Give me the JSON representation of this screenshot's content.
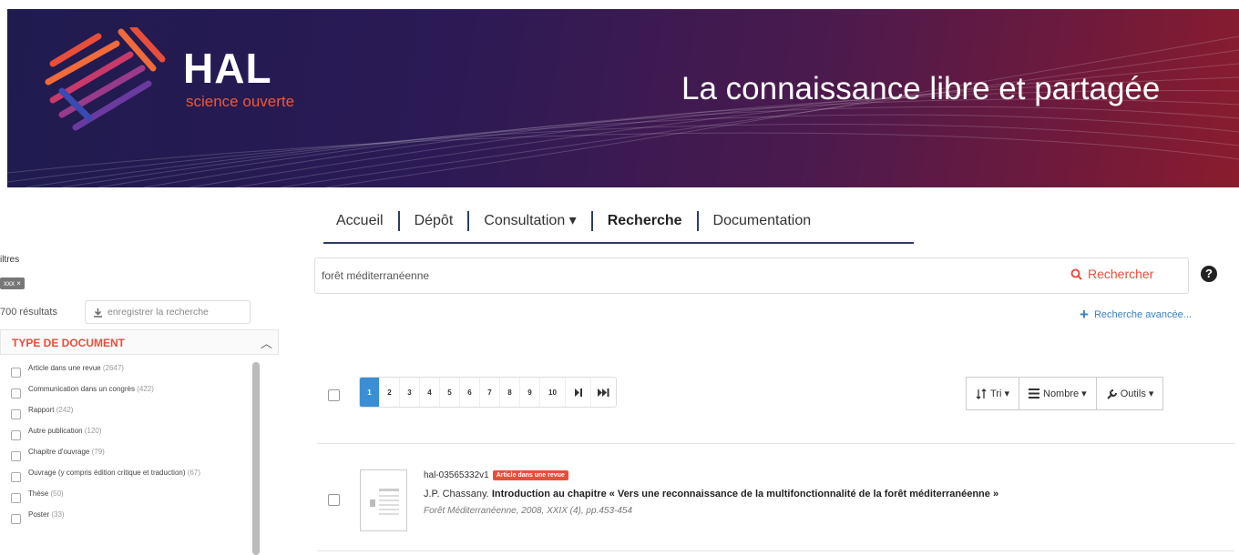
{
  "banner": {
    "logo_title": "HAL",
    "logo_subtitle": "science ouverte",
    "tagline": "La connaissance libre et partagée"
  },
  "nav": {
    "items": [
      "Accueil",
      "Dépôt",
      "Consultation ▾",
      "Recherche",
      "Documentation"
    ],
    "active": "Recherche"
  },
  "search": {
    "value": "forêt méditerranéenne",
    "button_label": "Rechercher",
    "help_icon": "?",
    "advanced_label": "Recherche avancée..."
  },
  "sidebar": {
    "filters_title": "iltres",
    "filter_badge": "xxx ×",
    "results_count": "700 résultats",
    "save_search_label": "enregistrer la recherche",
    "facet": {
      "title": "TYPE DE DOCUMENT",
      "items": [
        {
          "label": "Article dans une revue",
          "count": "(2647)"
        },
        {
          "label": "Communication dans un congrès",
          "count": "(422)"
        },
        {
          "label": "Rapport",
          "count": "(242)"
        },
        {
          "label": "Autre publication",
          "count": "(120)"
        },
        {
          "label": "Chapitre d'ouvrage",
          "count": "(79)"
        },
        {
          "label": "Ouvrage (y compris édition critique et traduction)",
          "count": "(67)"
        },
        {
          "label": "Thèse",
          "count": "(50)"
        },
        {
          "label": "Poster",
          "count": "(33)"
        }
      ]
    }
  },
  "pagination": {
    "pages": [
      "1",
      "2",
      "3",
      "4",
      "5",
      "6",
      "7",
      "8",
      "9",
      "10"
    ],
    "active": "1",
    "next_label": "⏭",
    "last_label": "⏭⏭"
  },
  "toolbar": {
    "sort_label": "Tri ▾",
    "count_label": "Nombre ▾",
    "tools_label": "Outils ▾"
  },
  "result": {
    "id": "hal-03565332v1",
    "badge": "Article dans une revue",
    "authors": "J.P. Chassany.",
    "title": "Introduction au chapitre « Vers une reconnaissance de la multifonctionnalité de la forêt méditerranéenne »",
    "source": "Forêt Méditerranéenne, 2008, XXIX (4), pp.453-454"
  },
  "colors": {
    "accent": "#e84e3a",
    "link": "#3a7fc0",
    "active_page": "#3a8fd4",
    "nav_underline": "#2c3e66"
  }
}
